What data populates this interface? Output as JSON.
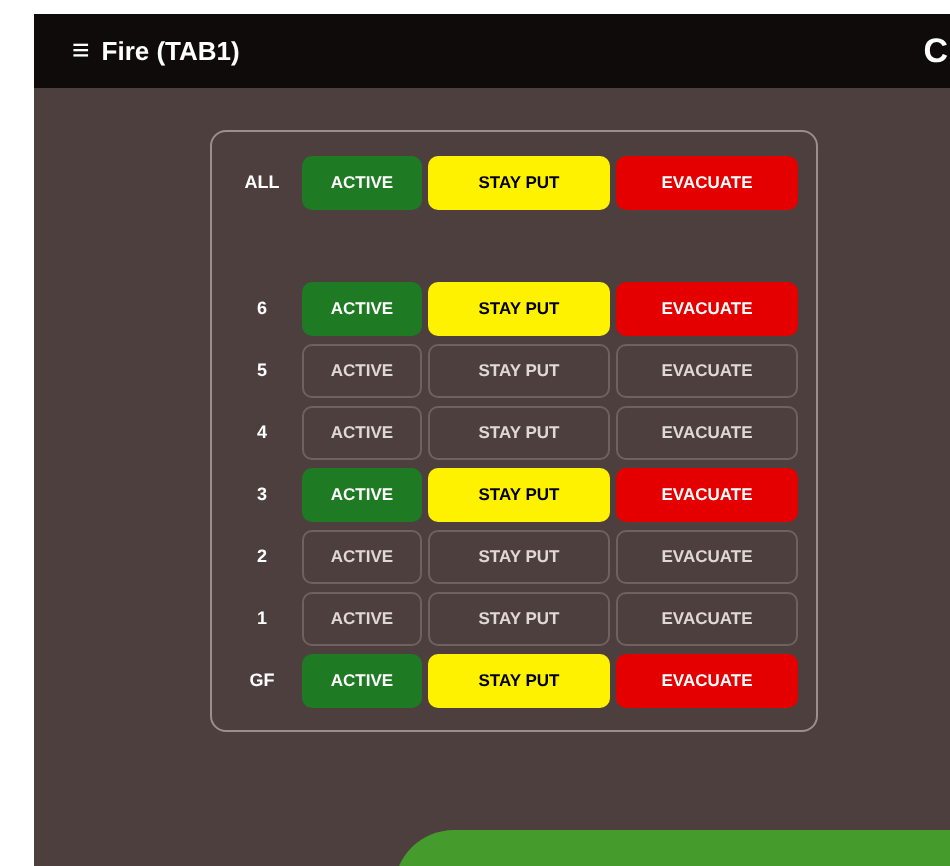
{
  "header": {
    "menu_icon": "≡",
    "title": "Fire (TAB1)",
    "right_text": "C"
  },
  "rows": [
    {
      "label": "ALL",
      "on": true,
      "buttons": [
        {
          "label": "ACTIVE",
          "kind": "active"
        },
        {
          "label": "STAY PUT",
          "kind": "stay"
        },
        {
          "label": "EVACUATE",
          "kind": "evacuate"
        }
      ]
    },
    {
      "label": "6",
      "on": true,
      "buttons": [
        {
          "label": "ACTIVE",
          "kind": "active"
        },
        {
          "label": "STAY PUT",
          "kind": "stay"
        },
        {
          "label": "EVACUATE",
          "kind": "evacuate"
        }
      ]
    },
    {
      "label": "5",
      "on": false,
      "buttons": [
        {
          "label": "ACTIVE",
          "kind": "active"
        },
        {
          "label": "STAY PUT",
          "kind": "stay"
        },
        {
          "label": "EVACUATE",
          "kind": "evacuate"
        }
      ]
    },
    {
      "label": "4",
      "on": false,
      "buttons": [
        {
          "label": "ACTIVE",
          "kind": "active"
        },
        {
          "label": "STAY PUT",
          "kind": "stay"
        },
        {
          "label": "EVACUATE",
          "kind": "evacuate"
        }
      ]
    },
    {
      "label": "3",
      "on": true,
      "buttons": [
        {
          "label": "ACTIVE",
          "kind": "active"
        },
        {
          "label": "STAY PUT",
          "kind": "stay"
        },
        {
          "label": "EVACUATE",
          "kind": "evacuate"
        }
      ]
    },
    {
      "label": "2",
      "on": false,
      "buttons": [
        {
          "label": "ACTIVE",
          "kind": "active"
        },
        {
          "label": "STAY PUT",
          "kind": "stay"
        },
        {
          "label": "EVACUATE",
          "kind": "evacuate"
        }
      ]
    },
    {
      "label": "1",
      "on": false,
      "buttons": [
        {
          "label": "ACTIVE",
          "kind": "active"
        },
        {
          "label": "STAY PUT",
          "kind": "stay"
        },
        {
          "label": "EVACUATE",
          "kind": "evacuate"
        }
      ]
    },
    {
      "label": "GF",
      "on": true,
      "buttons": [
        {
          "label": "ACTIVE",
          "kind": "active"
        },
        {
          "label": "STAY PUT",
          "kind": "stay"
        },
        {
          "label": "EVACUATE",
          "kind": "evacuate"
        }
      ]
    }
  ]
}
